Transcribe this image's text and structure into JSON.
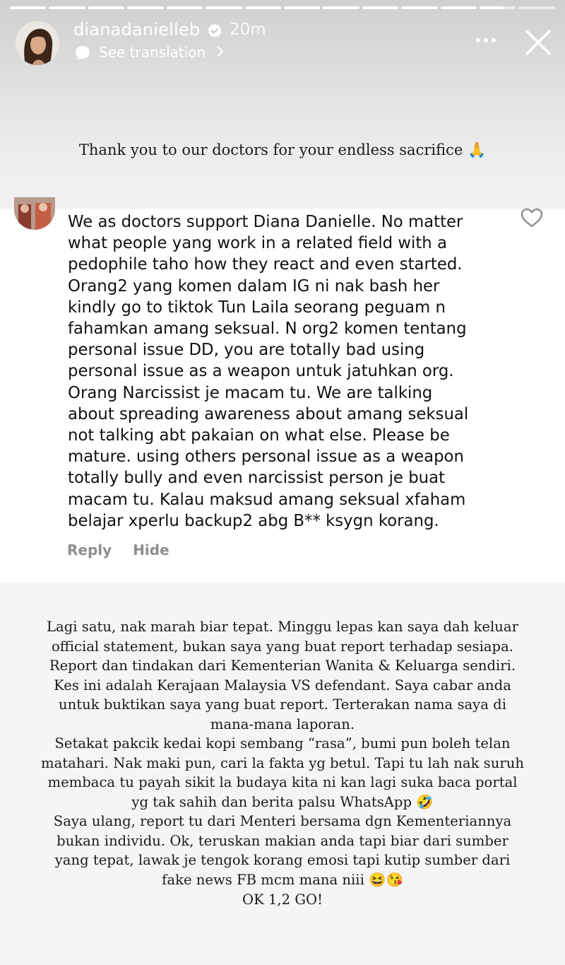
{
  "story": {
    "username": "dianadanielleb",
    "age": "20m",
    "see_translation": "See translation",
    "progress": {
      "segments": 14,
      "completed": 12,
      "active_fraction": 0.65
    },
    "icons": [
      "verified-badge-icon",
      "translate-icon",
      "chevron-right-icon",
      "more-options-icon",
      "close-icon"
    ],
    "caption": "Thank you to our doctors for your endless sacrifice 🙏"
  },
  "comment": {
    "text": "We as doctors support Diana Danielle. No matter\nwhat people yang work in a related field with a\npedophile taho how they react and even started.\nOrang2 yang komen dalam IG ni nak bash her\nkindly go to tiktok Tun Laila seorang peguam n\nfahamkan amang seksual. N org2 komen tentang\npersonal issue DD, you are totally bad using\npersonal issue as a weapon untuk jatuhkan org.\nOrang Narcissist je macam tu. We are talking\nabout spreading awareness about amang seksual\nnot talking abt pakaian on what else. Please be\nmature. using others personal issue as a weapon\ntotally bully and even narcissist person je buat\nmacam tu.  Kalau maksud amang seksual xfaham\nbelajar xperlu backup2 abg B** ksygn korang.",
    "reply_label": "Reply",
    "hide_label": "Hide",
    "icons": [
      "heart-icon"
    ]
  },
  "statement": {
    "text": "Lagi satu, nak marah biar tepat. Minggu lepas kan saya dah keluar\nofficial statement, bukan saya yang buat report terhadap sesiapa.\nReport dan tindakan dari Kementerian Wanita & Keluarga sendiri.\nKes ini adalah Kerajaan Malaysia VS defendant. Saya cabar anda\nuntuk buktikan saya yang buat report. Terterakan nama saya di\nmana-mana laporan.\nSetakat pakcik kedai kopi sembang “rasa”, bumi pun boleh telan\nmatahari. Nak maki pun, cari la fakta yg betul. Tapi tu lah nak suruh\nmembaca tu payah sikit la budaya kita ni kan lagi suka baca portal\nyg tak sahih dan berita palsu WhatsApp 🤣\nSaya ulang, report tu dari Menteri bersama dgn Kementeriannya\nbukan individu. Ok, teruskan makian anda tapi biar dari sumber\nyang tepat, lawak je tengok korang emosi tapi kutip sumber dari\nfake news FB mcm mana niii 😆😘",
    "closing": "OK 1,2 GO!"
  },
  "colors": {
    "header_text": "#ffffff",
    "verified_blue": "#3897f0",
    "muted_gray": "#8e8e8e",
    "text_dark": "#111111"
  }
}
